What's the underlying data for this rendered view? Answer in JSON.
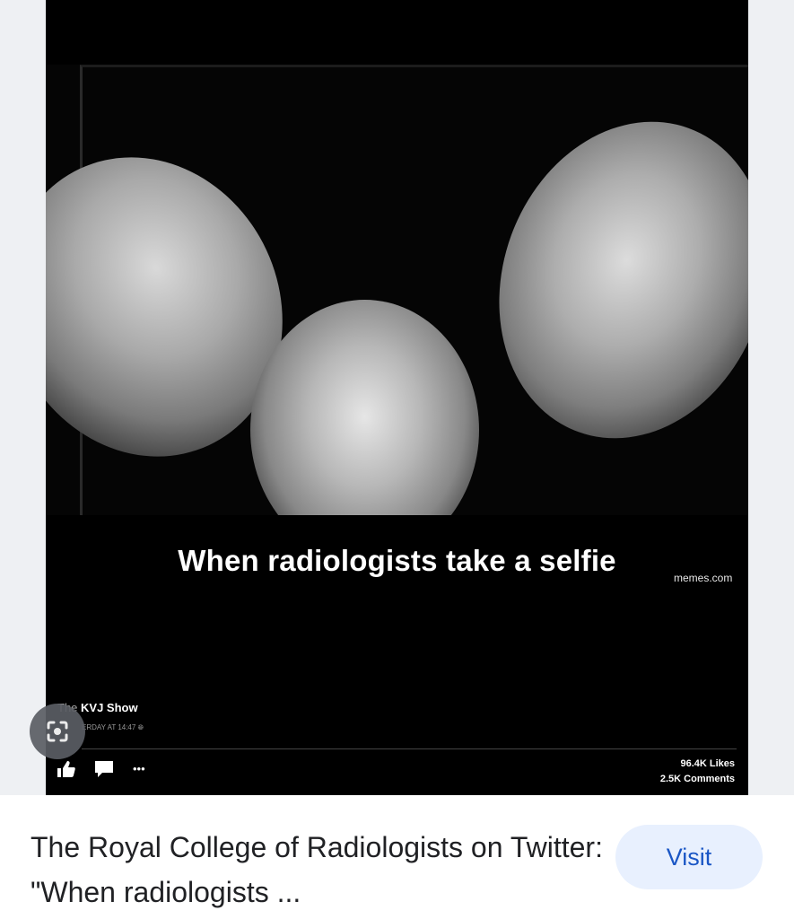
{
  "image": {
    "caption": "When radiologists take a selfie",
    "watermark": "memes.com",
    "post": {
      "page_prefix": "The",
      "page_name": "KVJ Show",
      "timestamp": "ERDAY AT 14:47",
      "likes": "96.4K Likes",
      "comments": "2.5K Comments",
      "actions": {
        "more_label": "•••"
      }
    }
  },
  "result": {
    "title": "The Royal College of Radiologists on Twitter: \"When radiologists ...",
    "visit_label": "Visit"
  },
  "colors": {
    "visit_bg": "#e8f0fe",
    "visit_text": "#1a56c5",
    "lens_bg": "#5b5e64"
  },
  "icons": [
    "lens-icon",
    "like-icon",
    "comment-icon",
    "more-icon",
    "globe-icon"
  ]
}
